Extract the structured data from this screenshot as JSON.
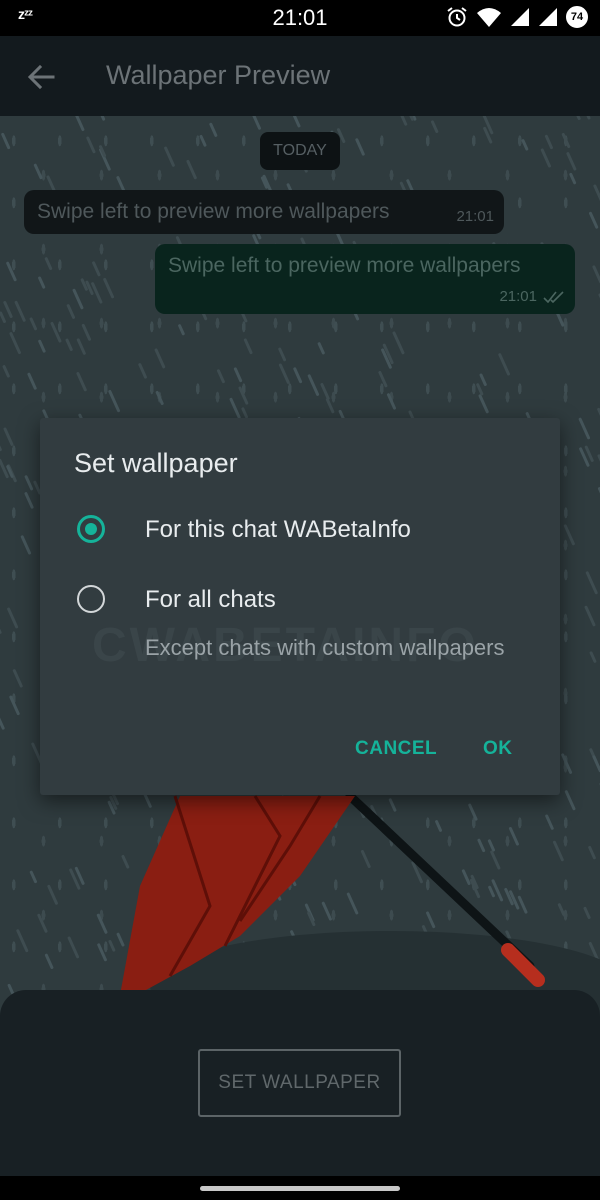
{
  "status_bar": {
    "zzz": "zᶻᶻ",
    "time": "21:01",
    "battery": "74"
  },
  "app_bar": {
    "title": "Wallpaper Preview"
  },
  "chat_preview": {
    "date_chip": "TODAY",
    "incoming": {
      "text": "Swipe left to preview more wallpapers",
      "time": "21:01"
    },
    "outgoing": {
      "text": "Swipe left to preview more wallpapers",
      "time": "21:01"
    }
  },
  "dialog": {
    "title": "Set wallpaper",
    "options": [
      {
        "label": "For this chat WABetaInfo",
        "selected": true
      },
      {
        "label": "For all chats",
        "selected": false,
        "sublabel": "Except chats with custom wallpapers"
      }
    ],
    "watermark": "CWABETAINFO",
    "cancel_label": "CANCEL",
    "ok_label": "OK"
  },
  "set_wallpaper_button": "SET WALLPAPER",
  "colors": {
    "accent": "#15b39a",
    "dialog_bg": "#323c40",
    "wallpaper_bg": "#2f3b3e",
    "umbrella": "#8a1e12"
  },
  "icons": [
    "moon-sleep-icon",
    "alarm-icon",
    "wifi-icon",
    "signal-icon",
    "back-arrow-icon",
    "double-check-icon"
  ]
}
